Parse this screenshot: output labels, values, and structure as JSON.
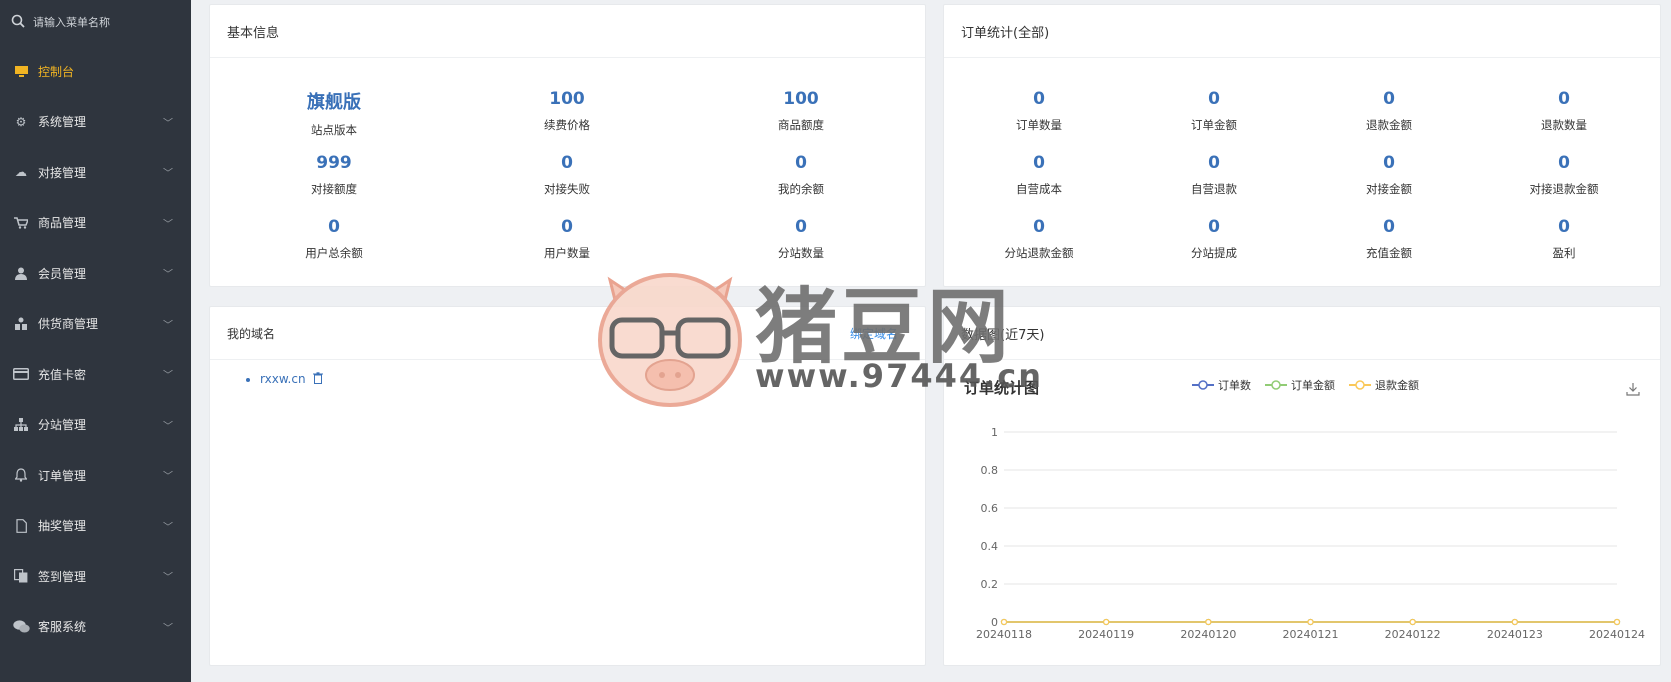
{
  "sidebar": {
    "search_placeholder": "请输入菜单名称",
    "items": [
      {
        "label": "控制台",
        "icon": "monitor-icon",
        "active": true
      },
      {
        "label": "系统管理",
        "icon": "gears-icon"
      },
      {
        "label": "对接管理",
        "icon": "cloud-icon"
      },
      {
        "label": "商品管理",
        "icon": "cart-icon"
      },
      {
        "label": "会员管理",
        "icon": "user-icon"
      },
      {
        "label": "供货商管理",
        "icon": "supplier-icon"
      },
      {
        "label": "充值卡密",
        "icon": "card-icon"
      },
      {
        "label": "分站管理",
        "icon": "sitemap-icon"
      },
      {
        "label": "订单管理",
        "icon": "bell-icon"
      },
      {
        "label": "抽奖管理",
        "icon": "file-icon"
      },
      {
        "label": "签到管理",
        "icon": "copy-icon"
      },
      {
        "label": "客服系统",
        "icon": "wechat-icon"
      }
    ]
  },
  "basic_info": {
    "title": "基本信息",
    "stats": [
      {
        "value": "旗舰版",
        "label": "站点版本"
      },
      {
        "value": "100",
        "label": "续费价格"
      },
      {
        "value": "100",
        "label": "商品额度"
      },
      {
        "value": "999",
        "label": "对接额度"
      },
      {
        "value": "0",
        "label": "对接失败"
      },
      {
        "value": "0",
        "label": "我的余额"
      },
      {
        "value": "0",
        "label": "用户总余额"
      },
      {
        "value": "0",
        "label": "用户数量"
      },
      {
        "value": "0",
        "label": "分站数量"
      }
    ]
  },
  "order_stats": {
    "title": "订单统计(全部)",
    "stats": [
      {
        "value": "0",
        "label": "订单数量"
      },
      {
        "value": "0",
        "label": "订单金额"
      },
      {
        "value": "0",
        "label": "退款金额"
      },
      {
        "value": "0",
        "label": "退款数量"
      },
      {
        "value": "0",
        "label": "自营成本"
      },
      {
        "value": "0",
        "label": "自营退款"
      },
      {
        "value": "0",
        "label": "对接金额"
      },
      {
        "value": "0",
        "label": "对接退款金额"
      },
      {
        "value": "0",
        "label": "分站退款金额"
      },
      {
        "value": "0",
        "label": "分站提成"
      },
      {
        "value": "0",
        "label": "充值金额"
      },
      {
        "value": "0",
        "label": "盈利"
      }
    ]
  },
  "domains": {
    "title": "我的域名",
    "bind_label": "绑定域名",
    "items": [
      "rxxw.cn"
    ]
  },
  "data_chart": {
    "title": "数据图(近7天)",
    "colors": {
      "orders": "#5470c6",
      "amount": "#91cc75",
      "refund": "#fac858"
    }
  },
  "watermark": {
    "text": "猪豆网",
    "url": "www.97444.cn"
  },
  "chart_data": {
    "type": "line",
    "title": "订单统计图",
    "categories": [
      "20240118",
      "20240119",
      "20240120",
      "20240121",
      "20240122",
      "20240123",
      "20240124"
    ],
    "series": [
      {
        "name": "订单数",
        "values": [
          0,
          0,
          0,
          0,
          0,
          0,
          0
        ]
      },
      {
        "name": "订单金额",
        "values": [
          0,
          0,
          0,
          0,
          0,
          0,
          0
        ]
      },
      {
        "name": "退款金额",
        "values": [
          0,
          0,
          0,
          0,
          0,
          0,
          0
        ]
      }
    ],
    "yticks": [
      "0",
      "0.2",
      "0.4",
      "0.6",
      "0.8",
      "1"
    ],
    "ylim": [
      0,
      1
    ],
    "grid": true,
    "legend": "top-center"
  }
}
